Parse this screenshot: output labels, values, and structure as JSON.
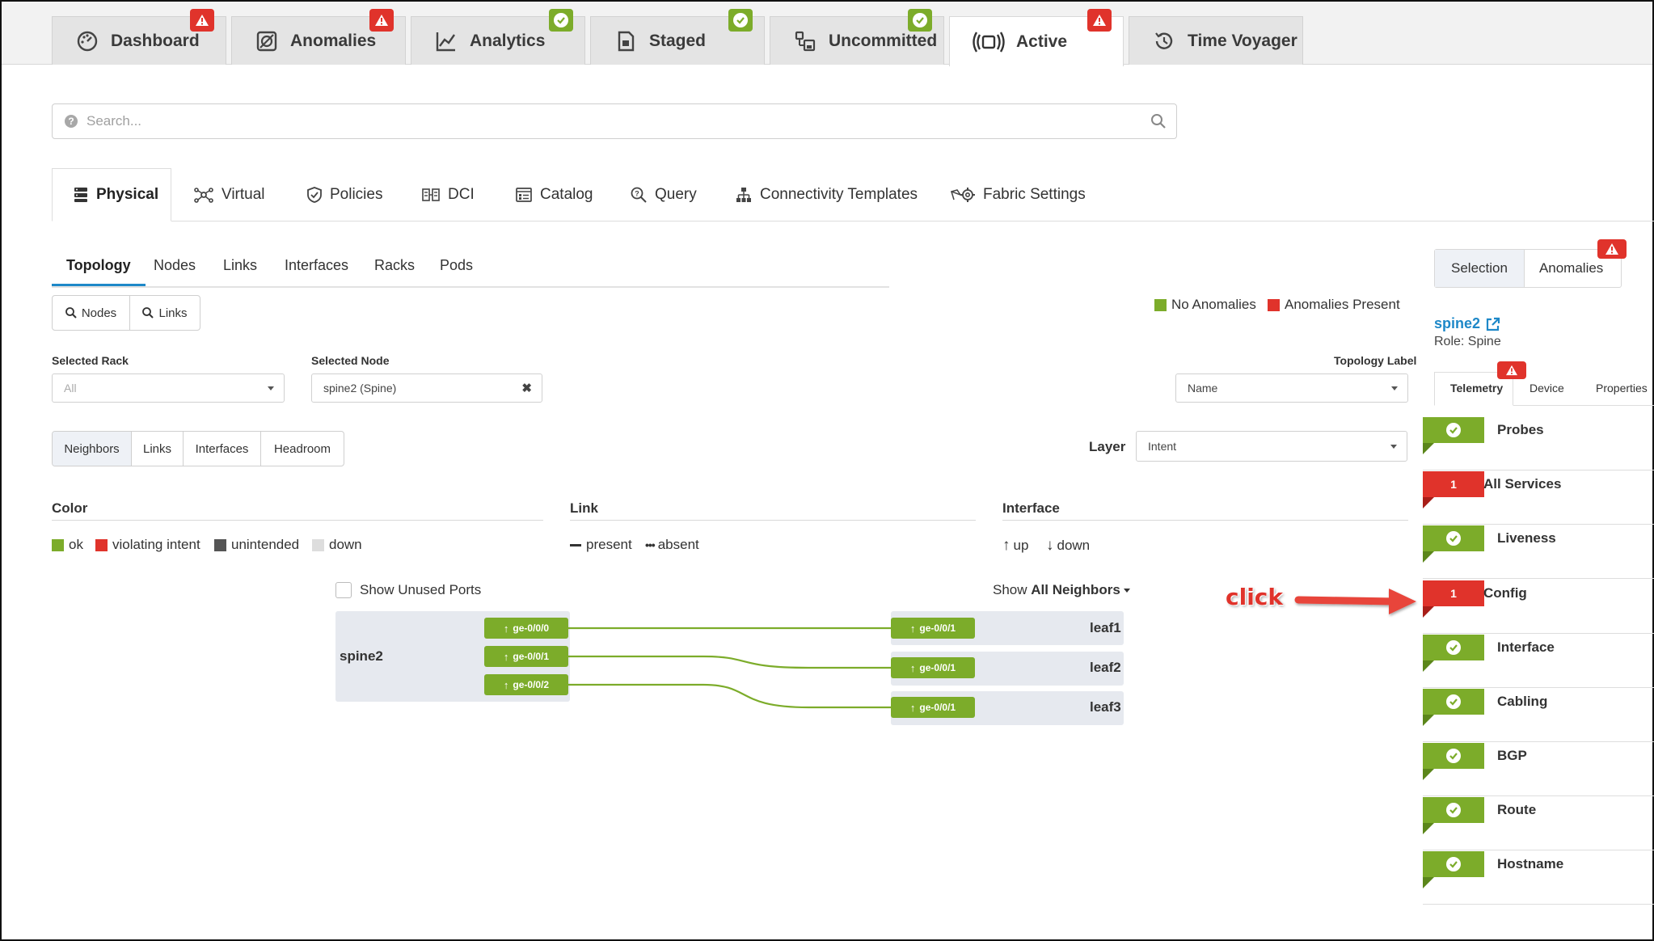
{
  "top_tabs": [
    {
      "label": "Dashboard",
      "badge": "red"
    },
    {
      "label": "Anomalies",
      "badge": "red"
    },
    {
      "label": "Analytics",
      "badge": "green"
    },
    {
      "label": "Staged",
      "badge": "green"
    },
    {
      "label": "Uncommitted",
      "badge": "green"
    },
    {
      "label": "Active",
      "badge": "red",
      "active": true
    },
    {
      "label": "Time Voyager"
    }
  ],
  "search": {
    "placeholder": "Search..."
  },
  "sub_tabs": [
    {
      "label": "Physical",
      "icon": "server-stack-icon",
      "active": true
    },
    {
      "label": "Virtual",
      "icon": "network-icon"
    },
    {
      "label": "Policies",
      "icon": "shield-check-icon"
    },
    {
      "label": "DCI",
      "icon": "dci-icon"
    },
    {
      "label": "Catalog",
      "icon": "catalog-icon"
    },
    {
      "label": "Query",
      "icon": "query-icon"
    },
    {
      "label": "Connectivity Templates",
      "icon": "hierarchy-icon"
    },
    {
      "label": "Fabric Settings",
      "icon": "fabric-settings-icon"
    }
  ],
  "physical_tabs": [
    "Topology",
    "Nodes",
    "Links",
    "Interfaces",
    "Racks",
    "Pods"
  ],
  "search_buttons": [
    "Nodes",
    "Links"
  ],
  "anomaly_legend": {
    "none": "No Anomalies",
    "present": "Anomalies Present"
  },
  "filters": {
    "selected_rack_label": "Selected Rack",
    "selected_rack_value": "All",
    "selected_node_label": "Selected Node",
    "selected_node_value": "spine2 (Spine)",
    "topology_label_label": "Topology Label",
    "topology_label_value": "Name",
    "layer_label": "Layer",
    "layer_value": "Intent"
  },
  "view_buttons": [
    "Neighbors",
    "Links",
    "Interfaces",
    "Headroom"
  ],
  "legend": {
    "color_title": "Color",
    "color_items": [
      "ok",
      "violating intent",
      "unintended",
      "down"
    ],
    "link_title": "Link",
    "link_items": [
      "present",
      "absent"
    ],
    "interface_title": "Interface",
    "interface_items": [
      "up",
      "down"
    ]
  },
  "topology": {
    "show_unused_ports": "Show Unused Ports",
    "show_prefix": "Show",
    "show_value": "All Neighbors",
    "source": {
      "name": "spine2",
      "ports": [
        "ge-0/0/0",
        "ge-0/0/1",
        "ge-0/0/2"
      ]
    },
    "neighbors": [
      {
        "name": "leaf1",
        "port": "ge-0/0/1"
      },
      {
        "name": "leaf2",
        "port": "ge-0/0/1"
      },
      {
        "name": "leaf3",
        "port": "ge-0/0/1"
      }
    ]
  },
  "right_panel": {
    "tabs": [
      "Selection",
      "Anomalies"
    ],
    "node_link": "spine2",
    "role": "Role: Spine",
    "inner_tabs": [
      "Telemetry",
      "Device",
      "Properties"
    ],
    "probes": [
      {
        "name": "Probes",
        "status": "ok"
      },
      {
        "name": "All Services",
        "status": "bad",
        "count": "1"
      },
      {
        "name": "Liveness",
        "status": "ok"
      },
      {
        "name": "Config",
        "status": "bad",
        "count": "1"
      },
      {
        "name": "Interface",
        "status": "ok"
      },
      {
        "name": "Cabling",
        "status": "ok"
      },
      {
        "name": "BGP",
        "status": "ok"
      },
      {
        "name": "Route",
        "status": "ok"
      },
      {
        "name": "Hostname",
        "status": "ok"
      }
    ]
  },
  "annotation": {
    "text": "click"
  },
  "colors": {
    "ok": "#7cac2a",
    "bad": "#e0332b",
    "unintended": "#555555",
    "down": "#dddddd",
    "link": "#1e88c8"
  }
}
